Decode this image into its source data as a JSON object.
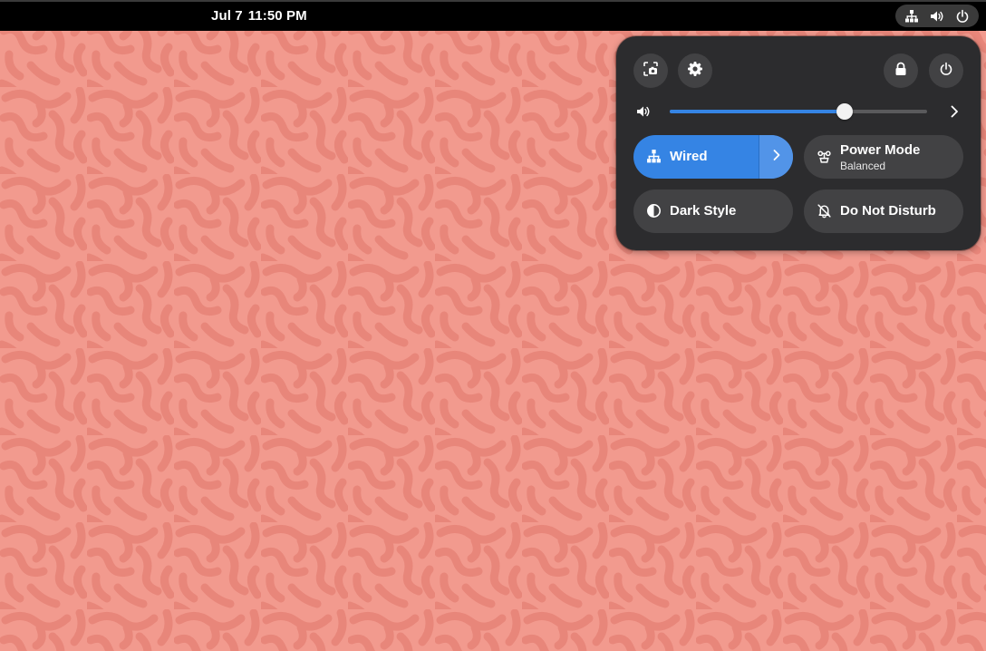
{
  "topbar": {
    "date": "Jul 7",
    "time": "11:50 PM",
    "status_icons": [
      "network-wired-icon",
      "volume-icon",
      "power-icon"
    ]
  },
  "quick_settings": {
    "top_buttons": [
      "screenshot-icon",
      "settings-gear-icon",
      "lock-icon",
      "power-icon"
    ],
    "volume": {
      "level_fraction": 0.68,
      "icon": "volume-high-icon"
    },
    "tiles": {
      "wired": {
        "title": "Wired",
        "active": true,
        "icon": "network-wired-icon"
      },
      "power_mode": {
        "title": "Power Mode",
        "subtitle": "Balanced",
        "icon": "power-profile-icon"
      },
      "dark_style": {
        "title": "Dark Style",
        "icon": "dark-mode-icon"
      },
      "do_not_disturb": {
        "title": "Do Not Disturb",
        "icon": "bell-off-icon"
      }
    }
  },
  "colors": {
    "accent": "#3584e4",
    "panel_bg": "#2c2c2e",
    "tile_bg": "#424244",
    "wallpaper_base": "#f29a8e",
    "wallpaper_pattern": "#e8867a"
  }
}
